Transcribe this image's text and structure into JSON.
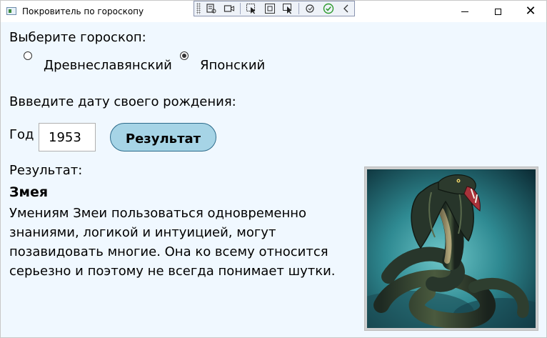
{
  "window": {
    "title": "Покровитель по гороскопу",
    "controls": {
      "minimize": "minimize-icon",
      "maximize": "maximize-icon",
      "close": "close-icon"
    }
  },
  "debug_toolbar": {
    "icons": [
      "live-visual-tree-icon",
      "record-icon",
      "select-element-icon",
      "display-layout-adorners-icon",
      "track-focused-element-icon",
      "hot-reload-icon",
      "binding-failures-check-icon",
      "collapse-chevron-icon"
    ]
  },
  "horoscope": {
    "prompt": "Выберите гороскоп:",
    "options": [
      {
        "label": "Древнеславянский",
        "selected": false
      },
      {
        "label": "Японский",
        "selected": true
      }
    ]
  },
  "birth": {
    "prompt": "Ввведите дату своего рождения:",
    "year_label": "Год",
    "year_value": "1953",
    "button_label": "Результат"
  },
  "result": {
    "label": "Результат:",
    "sign": "Змея",
    "lines": [
      "Умениям Змеи пользоваться одновременно",
      "знаниями, логикой и интуицией, могут",
      "позавидовать многие. Она ко всему относится",
      "серьезно и поэтому не всегда понимает шутки."
    ],
    "image": "cobra-snake-image"
  },
  "colors": {
    "window_bg": "#f0f8ff",
    "button_bg": "#a6d4e6",
    "button_border": "#2c6a8a"
  }
}
